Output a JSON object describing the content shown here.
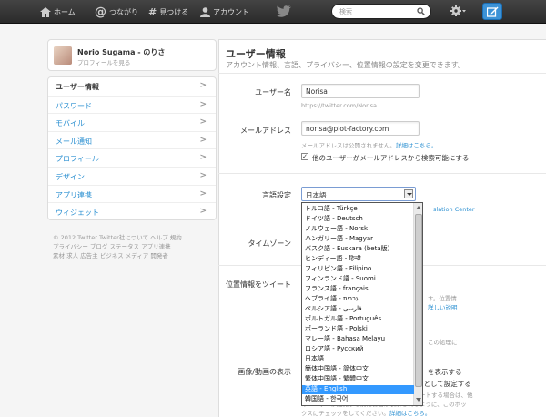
{
  "topbar": {
    "nav": [
      {
        "label": "ホーム",
        "icon": "home-icon"
      },
      {
        "label": "つながり",
        "icon": "at-icon"
      },
      {
        "label": "見つける",
        "icon": "hash-icon"
      },
      {
        "label": "アカウント",
        "icon": "person-icon"
      }
    ],
    "search_placeholder": "検索",
    "brand_icon": "bird-icon",
    "accent": "#3c92d6"
  },
  "profile": {
    "name": "Norio Sugama - のりさ",
    "link": "プロフィールを見る"
  },
  "menu": [
    "ユーザー情報",
    "パスワード",
    "モバイル",
    "メール通知",
    "プロフィール",
    "デザイン",
    "アプリ連携",
    "ウィジェット"
  ],
  "footer": [
    "© 2012 Twitter  Twitter社について  ヘルプ  規約",
    "プライバシー  ブログ  ステータス  アプリ連携",
    "素材  求人  広告主  ビジネス  メディア  開発者"
  ],
  "main": {
    "title": "ユーザー情報",
    "subtitle": "アカウント情報、言語、プライバシー、位置情報の設定を変更できます。",
    "username_label": "ユーザー名",
    "username_value": "Norisa",
    "username_hint": "https://twitter.com/Norisa",
    "email_label": "メールアドレス",
    "email_value": "norisa@plot-factory.com",
    "email_hint": "メールアドレスは公開されません。",
    "email_hint_link": "詳細はこちら。",
    "email_check_label": "他のユーザーがメールアドレスから検索可能にする",
    "language_label": "言語設定",
    "language_value": "日本語",
    "translation_link": "slation Center",
    "timezone_label": "タイムゾーン",
    "location_label": "位置情報をツイート",
    "right_frag1": "す。位置情",
    "right_frag2": "詳しい説明",
    "right_frag3": "この処理に",
    "media_label": "画像/動画の表示",
    "media_right": "を表示する",
    "media_check_label": "画像/動画を不適切な内容を含むものとして設定する",
    "media_note1": "不適切なコンテンツを含む画像や動画をツイートする場合は、他",
    "media_note2": "のユーザーが閲覧する前に警告が表示されるように、このボッ",
    "media_note3": "クスにチェックをしてください。",
    "media_note_link": "詳細はこちら。"
  },
  "languages": [
    "トルコ語 - Türkçe",
    "ドイツ語 - Deutsch",
    "ノルウェー語 - Norsk",
    "ハンガリー語 - Magyar",
    "バスク語 - Euskara (beta版)",
    "ヒンディー語 - हिन्दी",
    "フィリピン語 - Filipino",
    "フィンランド語 - Suomi",
    "フランス語 - français",
    "ヘブライ語 - עברית",
    "ペルシア語 - فارسی",
    "ポルトガル語 - Português",
    "ポーランド語 - Polski",
    "マレー語 - Bahasa Melayu",
    "ロシア語 - Русский",
    "日本語",
    "簡体中国語 - 简体中文",
    "繁体中国語 - 繁體中文",
    "英語 - English",
    "韓国語 - 한국어"
  ],
  "selected_language_index": 18
}
